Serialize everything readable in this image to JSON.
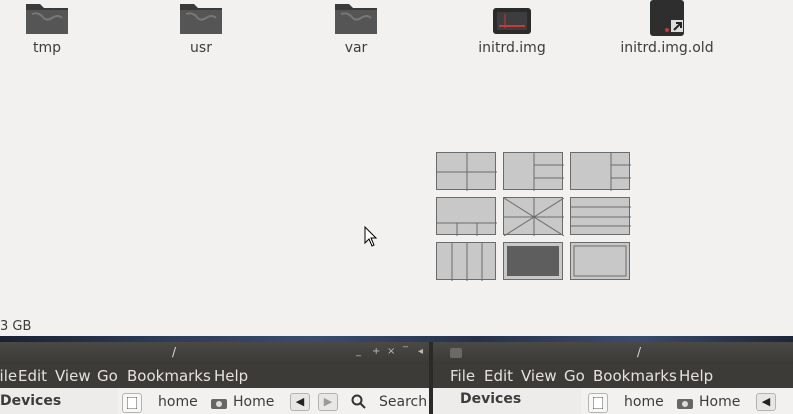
{
  "files": [
    {
      "label": "tmp",
      "icon": "folder-icon"
    },
    {
      "label": "usr",
      "icon": "folder-icon"
    },
    {
      "label": "var",
      "icon": "folder-icon"
    },
    {
      "label": "initrd.img",
      "icon": "image-file-icon"
    },
    {
      "label": "initrd.img.old",
      "icon": "symlink-file-icon"
    }
  ],
  "status": {
    "free_space": "3 GB"
  },
  "left_window": {
    "title": "/",
    "controls": [
      "_",
      "+",
      "×",
      "‾",
      "◂"
    ],
    "menu": [
      "File",
      "Edit",
      "View",
      "Go",
      "Bookmarks",
      "Help"
    ],
    "sidebar_heading": "Devices",
    "breadcrumbs": [
      "home",
      "Home"
    ],
    "search_label": "Search"
  },
  "right_window": {
    "title": "/",
    "menu": [
      "File",
      "Edit",
      "View",
      "Go",
      "Bookmarks",
      "Help"
    ],
    "sidebar_heading": "Devices",
    "breadcrumbs": [
      "home",
      "Home"
    ]
  },
  "colors": {
    "desktop_bg": "#f2f1f0",
    "panel_dark": "#3c3b37",
    "tile_fill": "#c8c8c8",
    "tile_border": "#6b6b6b"
  }
}
